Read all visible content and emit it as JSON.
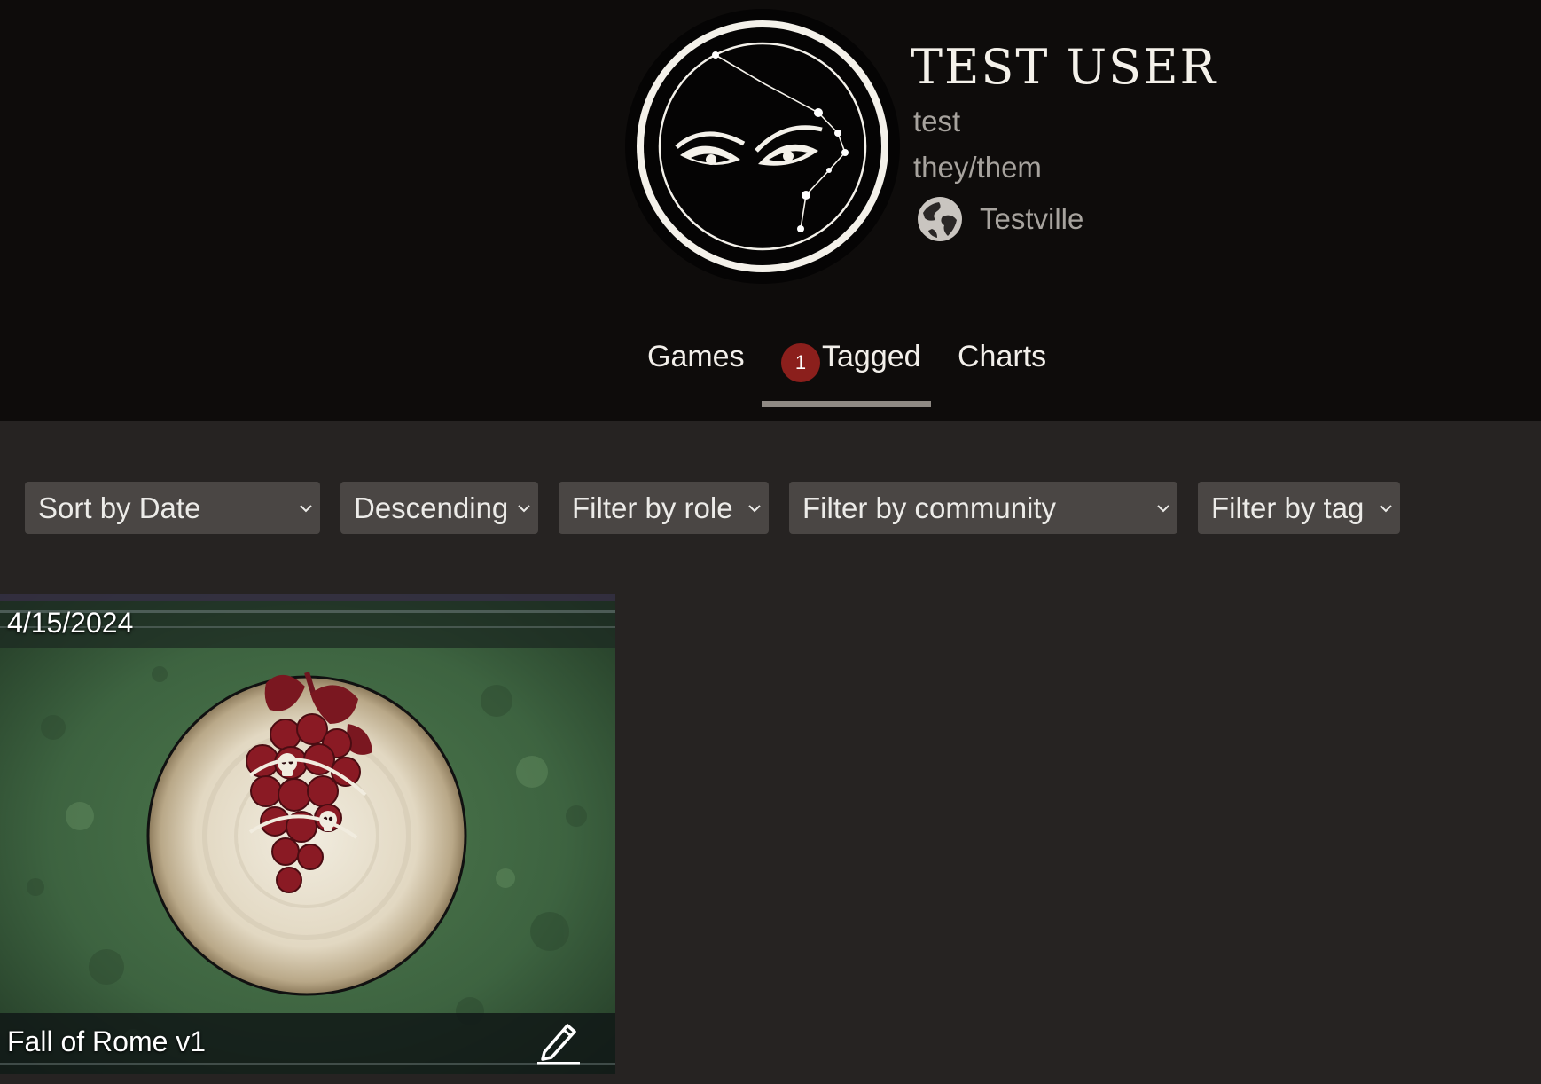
{
  "profile": {
    "display_name": "TEST USER",
    "username": "test",
    "pronouns": "they/them",
    "location": "Testville",
    "location_icon": "globe-icon"
  },
  "tabs": {
    "items": [
      {
        "label": "Games",
        "active": false
      },
      {
        "label": "Tagged",
        "active": true,
        "badge": "1"
      },
      {
        "label": "Charts",
        "active": false
      }
    ]
  },
  "filters": {
    "sort": "Sort by Date",
    "order": "Descending",
    "role": "Filter by role",
    "community": "Filter by community",
    "tag": "Filter by tag"
  },
  "games": [
    {
      "date": "4/15/2024",
      "title": "Fall of Rome v1",
      "emblem": "grapes-with-skulls",
      "action_icon": "pencil-icon"
    }
  ],
  "colors": {
    "header_bg": "#0e0c0b",
    "page_bg": "#262322",
    "select_bg": "#4a4644",
    "badge_bg": "#8b1f1c",
    "tab_underline": "#8f8a84",
    "muted_text": "#a7a39e",
    "card_green": "#3d6340",
    "emblem_red": "#7a1720"
  }
}
